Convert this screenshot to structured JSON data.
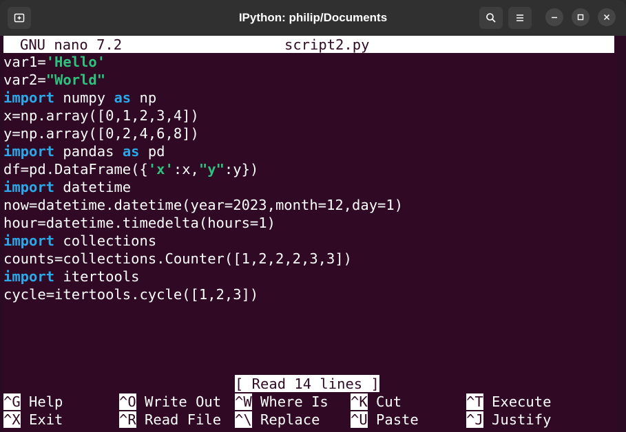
{
  "window": {
    "title": "IPython: philip/Documents",
    "icons": [
      "new-tab-icon",
      "search-icon",
      "hamburger-menu-icon",
      "minimize-icon",
      "maximize-icon",
      "close-icon"
    ]
  },
  "nano": {
    "version": "GNU nano 7.2",
    "filename": "script2.py",
    "status": "[ Read 14 lines ]"
  },
  "code": {
    "l1": {
      "a": "var1=",
      "b": "'Hello'"
    },
    "l2": {
      "a": "var2=",
      "b": "\"World\""
    },
    "l3": {
      "kw1": "import",
      "mid": " numpy ",
      "kw2": "as",
      "end": " np"
    },
    "l4": "x=np.array([0,1,2,3,4])",
    "l5": "y=np.array([0,2,4,6,8])",
    "l6": {
      "kw1": "import",
      "mid": " pandas ",
      "kw2": "as",
      "end": " pd"
    },
    "l7": {
      "a": "df=pd.DataFrame({",
      "s1": "'x'",
      "b": ":x,",
      "s2": "\"y\"",
      "c": ":y})"
    },
    "l8": {
      "kw": "import",
      "rest": " datetime"
    },
    "l9": "now=datetime.datetime(year=2023,month=12,day=1)",
    "l10": "hour=datetime.timedelta(hours=1)",
    "l11": {
      "kw": "import",
      "rest": " collections"
    },
    "l12": "counts=collections.Counter([1,2,2,2,3,3])",
    "l13": {
      "kw": "import",
      "rest": " itertools"
    },
    "l14": "cycle=itertools.cycle([1,2,3])"
  },
  "shortcuts": {
    "help": {
      "key": "^G",
      "label": " Help"
    },
    "write_out": {
      "key": "^O",
      "label": " Write Out"
    },
    "where_is": {
      "key": "^W",
      "label": " Where Is"
    },
    "cut": {
      "key": "^K",
      "label": " Cut"
    },
    "execute": {
      "key": "^T",
      "label": " Execute"
    },
    "exit": {
      "key": "^X",
      "label": " Exit"
    },
    "read_file": {
      "key": "^R",
      "label": " Read File"
    },
    "replace": {
      "key": "^\\",
      "label": " Replace"
    },
    "paste": {
      "key": "^U",
      "label": " Paste"
    },
    "justify": {
      "key": "^J",
      "label": " Justify"
    }
  },
  "colors": {
    "background": "#300a24",
    "titlebar": "#303030",
    "keyword": "#2aa8e8",
    "string": "#2ec27e",
    "text": "#ffffff"
  }
}
